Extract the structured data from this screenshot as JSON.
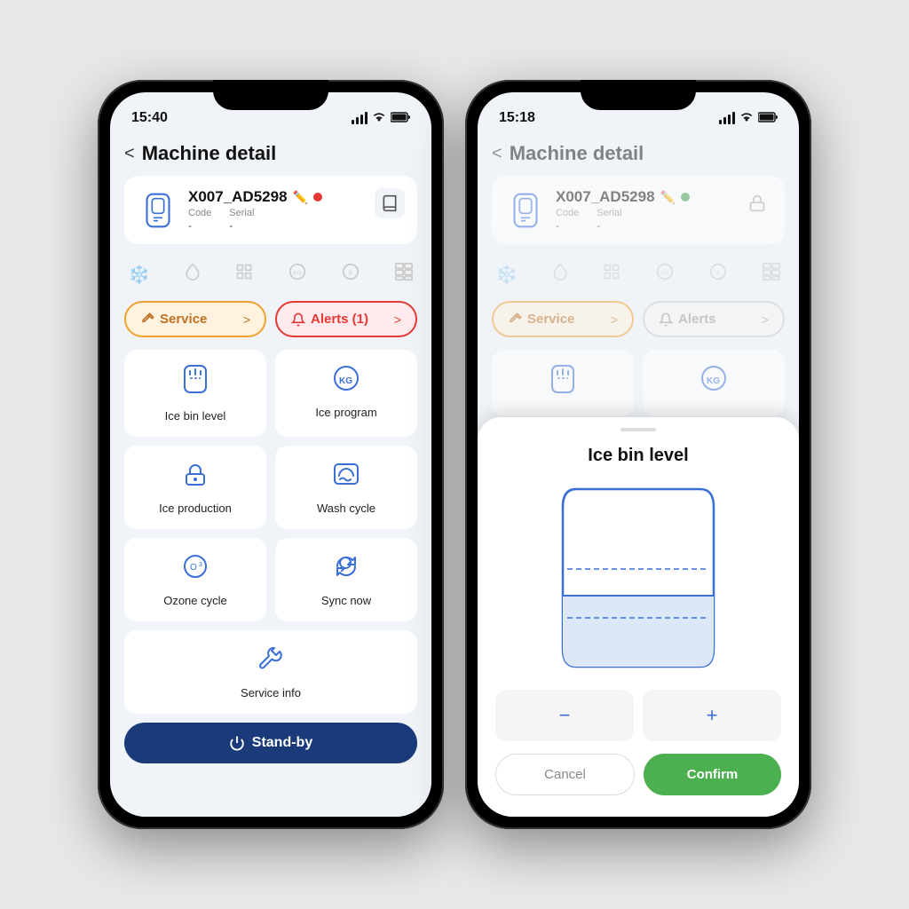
{
  "phone1": {
    "statusBar": {
      "time": "15:40"
    },
    "header": {
      "backLabel": "<",
      "title": "Machine detail"
    },
    "machine": {
      "name": "X007_AD5298",
      "codeLabel": "Code",
      "codeValue": "-",
      "serialLabel": "Serial",
      "serialValue": "-",
      "statusColor": "red"
    },
    "serviceBtn": {
      "label": "Service",
      "chevron": ">"
    },
    "alertsBtn": {
      "label": "Alerts (1)",
      "chevron": ">"
    },
    "gridItems": [
      {
        "icon": "ice-bin-icon",
        "label": "Ice bin level"
      },
      {
        "icon": "ice-program-icon",
        "label": "Ice program"
      },
      {
        "icon": "ice-production-icon",
        "label": "Ice production"
      },
      {
        "icon": "wash-cycle-icon",
        "label": "Wash cycle"
      },
      {
        "icon": "ozone-icon",
        "label": "Ozone cycle"
      },
      {
        "icon": "sync-icon",
        "label": "Sync now"
      }
    ],
    "serviceInfo": {
      "icon": "wrench-icon",
      "label": "Service info"
    },
    "standbyBtn": {
      "label": "Stand-by"
    }
  },
  "phone2": {
    "statusBar": {
      "time": "15:18"
    },
    "header": {
      "backLabel": "<",
      "title": "Machine detail"
    },
    "machine": {
      "name": "X007_AD5298",
      "codeLabel": "Code",
      "codeValue": "-",
      "serialLabel": "Serial",
      "serialValue": "-",
      "statusColor": "green"
    },
    "serviceBtn": {
      "label": "Service",
      "chevron": ">"
    },
    "alertsBtn": {
      "label": "Alerts",
      "chevron": ">"
    },
    "modal": {
      "handle": true,
      "title": "Ice bin level",
      "decrementLabel": "−",
      "incrementLabel": "+",
      "cancelLabel": "Cancel",
      "confirmLabel": "Confirm"
    }
  }
}
